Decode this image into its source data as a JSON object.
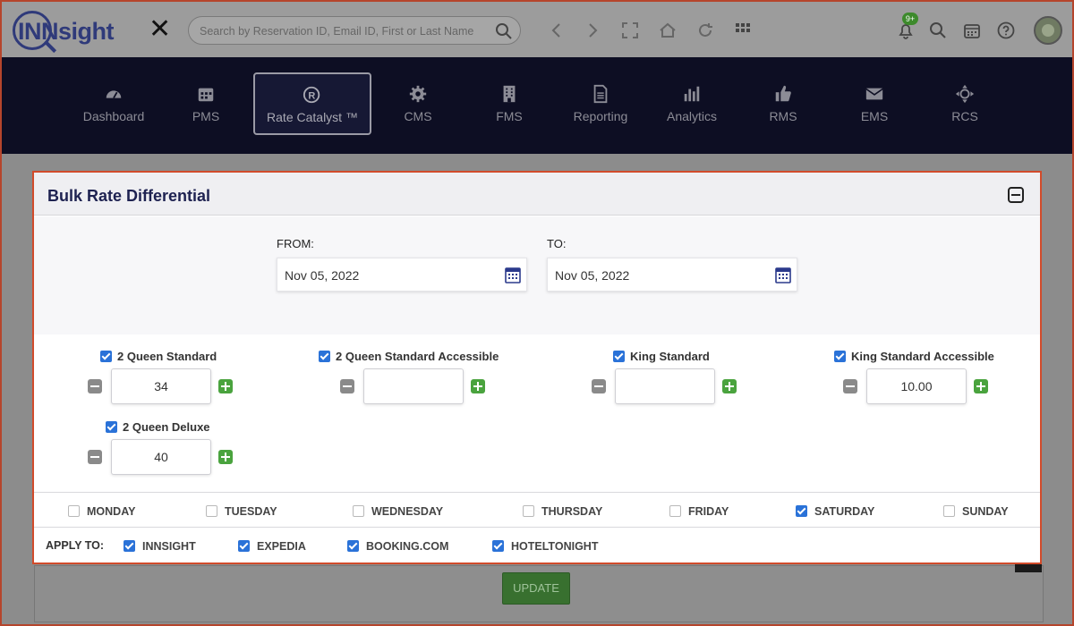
{
  "app": {
    "logo_text": "INNsight",
    "search_placeholder": "Search by Reservation ID, Email ID, First or Last Name",
    "notification_badge": "9+"
  },
  "nav": [
    {
      "label": "Dashboard",
      "icon": "dashboard-icon"
    },
    {
      "label": "PMS",
      "icon": "calendar-icon"
    },
    {
      "label": "Rate Catalyst ™",
      "icon": "rate-catalyst-icon",
      "active": true
    },
    {
      "label": "CMS",
      "icon": "gear-icon"
    },
    {
      "label": "FMS",
      "icon": "building-icon"
    },
    {
      "label": "Reporting",
      "icon": "document-icon"
    },
    {
      "label": "Analytics",
      "icon": "bar-chart-icon"
    },
    {
      "label": "RMS",
      "icon": "thumbs-up-icon"
    },
    {
      "label": "EMS",
      "icon": "envelope-icon"
    },
    {
      "label": "RCS",
      "icon": "crosshair-icon"
    }
  ],
  "modal": {
    "title": "Bulk Rate Differential",
    "from_label": "FROM:",
    "from_value": "Nov 05, 2022",
    "to_label": "TO:",
    "to_value": "Nov 05, 2022"
  },
  "rooms": [
    {
      "name": "2 Queen Standard",
      "checked": true,
      "value": "34"
    },
    {
      "name": "2 Queen Standard Accessible",
      "checked": true,
      "value": ""
    },
    {
      "name": "King Standard",
      "checked": true,
      "value": ""
    },
    {
      "name": "King Standard Accessible",
      "checked": true,
      "value": "10.00"
    },
    {
      "name": "2 Queen Deluxe",
      "checked": true,
      "value": "40"
    }
  ],
  "days": [
    {
      "label": "MONDAY",
      "checked": false
    },
    {
      "label": "TUESDAY",
      "checked": false
    },
    {
      "label": "WEDNESDAY",
      "checked": false
    },
    {
      "label": "THURSDAY",
      "checked": false
    },
    {
      "label": "FRIDAY",
      "checked": false
    },
    {
      "label": "SATURDAY",
      "checked": true
    },
    {
      "label": "SUNDAY",
      "checked": false
    }
  ],
  "apply_to": {
    "label": "APPLY TO:",
    "channels": [
      {
        "label": "INNSIGHT",
        "checked": true
      },
      {
        "label": "EXPEDIA",
        "checked": true
      },
      {
        "label": "BOOKING.COM",
        "checked": true
      },
      {
        "label": "HOTELTONIGHT",
        "checked": true
      }
    ]
  },
  "background": {
    "update_label": "UPDATE"
  },
  "colors": {
    "navy": "#1e2251",
    "modal_border": "#d14b2b",
    "checkbox_blue": "#2a72d8",
    "plus_green": "#4aa33e"
  }
}
